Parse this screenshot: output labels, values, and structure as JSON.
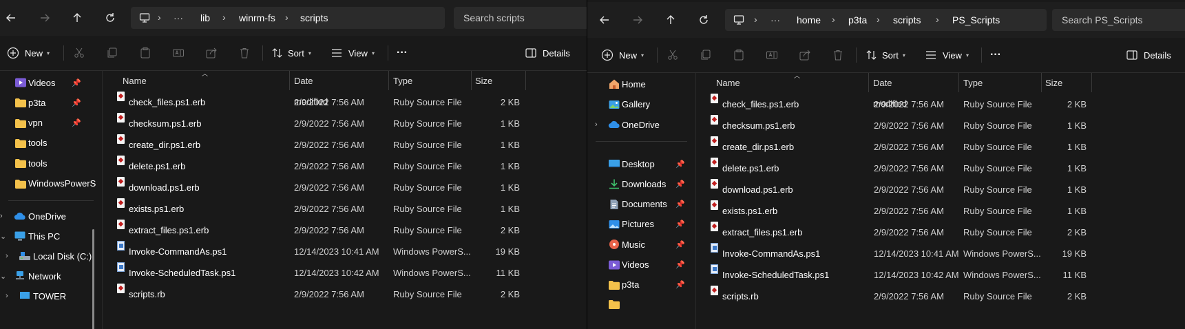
{
  "left": {
    "breadcrumb": [
      "lib",
      "winrm-fs",
      "scripts"
    ],
    "search_placeholder": "Search scripts",
    "toolbar": {
      "new": "New",
      "sort": "Sort",
      "view": "View",
      "more": "···",
      "details": "Details"
    },
    "columns": {
      "name": "Name",
      "date": "Date modified",
      "type": "Type",
      "size": "Size"
    },
    "sidebar": {
      "quick": [
        {
          "label": "Videos",
          "icon": "videos-folder-icon",
          "pinned": true
        },
        {
          "label": "p3ta",
          "icon": "folder-icon",
          "pinned": true
        },
        {
          "label": "vpn",
          "icon": "folder-icon",
          "pinned": true
        },
        {
          "label": "tools",
          "icon": "folder-icon",
          "pinned": false
        },
        {
          "label": "tools",
          "icon": "folder-icon",
          "pinned": false
        },
        {
          "label": "WindowsPowerS",
          "icon": "folder-icon",
          "pinned": false
        }
      ],
      "tree": [
        {
          "label": "OneDrive",
          "icon": "onedrive-cloud-icon",
          "expand": "›"
        },
        {
          "label": "This PC",
          "icon": "pc-monitor-icon",
          "expand": "⌄"
        },
        {
          "label": "Local Disk (C:)",
          "icon": "local-disk-icon",
          "expand": "›"
        },
        {
          "label": "Network",
          "icon": "network-icon",
          "expand": "⌄"
        },
        {
          "label": "TOWER",
          "icon": "computer-icon",
          "expand": "›"
        }
      ]
    }
  },
  "right": {
    "breadcrumb": [
      "home",
      "p3ta",
      "scripts",
      "PS_Scripts"
    ],
    "search_placeholder": "Search PS_Scripts",
    "toolbar": {
      "new": "New",
      "sort": "Sort",
      "view": "View",
      "more": "···",
      "details": "Details"
    },
    "columns": {
      "name": "Name",
      "date": "Date modified",
      "type": "Type",
      "size": "Size"
    },
    "sidebar": {
      "top": [
        {
          "label": "Home",
          "icon": "home-icon"
        },
        {
          "label": "Gallery",
          "icon": "gallery-icon"
        },
        {
          "label": "OneDrive",
          "icon": "onedrive-cloud-icon",
          "expand": "›"
        }
      ],
      "quick": [
        {
          "label": "Desktop",
          "icon": "desktop-folder-icon"
        },
        {
          "label": "Downloads",
          "icon": "downloads-folder-icon"
        },
        {
          "label": "Documents",
          "icon": "documents-folder-icon"
        },
        {
          "label": "Pictures",
          "icon": "pictures-folder-icon"
        },
        {
          "label": "Music",
          "icon": "music-folder-icon"
        },
        {
          "label": "Videos",
          "icon": "videos-folder-icon"
        },
        {
          "label": "p3ta",
          "icon": "folder-icon"
        }
      ]
    }
  },
  "files": [
    {
      "name": "check_files.ps1.erb",
      "date": "2/9/2022 7:56 AM",
      "type": "Ruby Source File",
      "size": "2 KB",
      "icon": "ruby-file-icon"
    },
    {
      "name": "checksum.ps1.erb",
      "date": "2/9/2022 7:56 AM",
      "type": "Ruby Source File",
      "size": "1 KB",
      "icon": "ruby-file-icon"
    },
    {
      "name": "create_dir.ps1.erb",
      "date": "2/9/2022 7:56 AM",
      "type": "Ruby Source File",
      "size": "1 KB",
      "icon": "ruby-file-icon"
    },
    {
      "name": "delete.ps1.erb",
      "date": "2/9/2022 7:56 AM",
      "type": "Ruby Source File",
      "size": "1 KB",
      "icon": "ruby-file-icon"
    },
    {
      "name": "download.ps1.erb",
      "date": "2/9/2022 7:56 AM",
      "type": "Ruby Source File",
      "size": "1 KB",
      "icon": "ruby-file-icon"
    },
    {
      "name": "exists.ps1.erb",
      "date": "2/9/2022 7:56 AM",
      "type": "Ruby Source File",
      "size": "1 KB",
      "icon": "ruby-file-icon"
    },
    {
      "name": "extract_files.ps1.erb",
      "date": "2/9/2022 7:56 AM",
      "type": "Ruby Source File",
      "size": "2 KB",
      "icon": "ruby-file-icon"
    },
    {
      "name": "Invoke-CommandAs.ps1",
      "date": "12/14/2023 10:41 AM",
      "type": "Windows PowerS...",
      "size": "19 KB",
      "icon": "powershell-file-icon"
    },
    {
      "name": "Invoke-ScheduledTask.ps1",
      "date": "12/14/2023 10:42 AM",
      "type": "Windows PowerS...",
      "size": "11 KB",
      "icon": "powershell-file-icon"
    },
    {
      "name": "scripts.rb",
      "date": "2/9/2022 7:56 AM",
      "type": "Ruby Source File",
      "size": "2 KB",
      "icon": "ruby-file-icon"
    }
  ],
  "colors": {
    "background": "#191919",
    "bar": "#1e1e1e",
    "field": "#2b2b2b",
    "folder": "#f3c14b",
    "accent": "#4aa3ff"
  }
}
